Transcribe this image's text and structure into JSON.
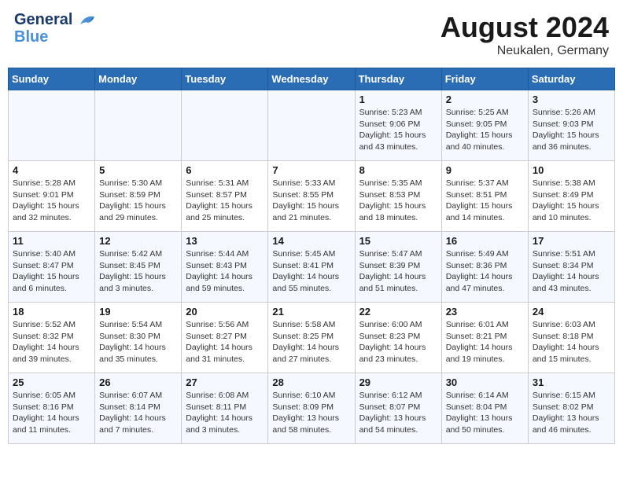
{
  "header": {
    "logo_line1": "General",
    "logo_line2": "Blue",
    "main_title": "August 2024",
    "subtitle": "Neukalen, Germany"
  },
  "days_of_week": [
    "Sunday",
    "Monday",
    "Tuesday",
    "Wednesday",
    "Thursday",
    "Friday",
    "Saturday"
  ],
  "weeks": [
    [
      {
        "day": "",
        "info": ""
      },
      {
        "day": "",
        "info": ""
      },
      {
        "day": "",
        "info": ""
      },
      {
        "day": "",
        "info": ""
      },
      {
        "day": "1",
        "info": "Sunrise: 5:23 AM\nSunset: 9:06 PM\nDaylight: 15 hours\nand 43 minutes."
      },
      {
        "day": "2",
        "info": "Sunrise: 5:25 AM\nSunset: 9:05 PM\nDaylight: 15 hours\nand 40 minutes."
      },
      {
        "day": "3",
        "info": "Sunrise: 5:26 AM\nSunset: 9:03 PM\nDaylight: 15 hours\nand 36 minutes."
      }
    ],
    [
      {
        "day": "4",
        "info": "Sunrise: 5:28 AM\nSunset: 9:01 PM\nDaylight: 15 hours\nand 32 minutes."
      },
      {
        "day": "5",
        "info": "Sunrise: 5:30 AM\nSunset: 8:59 PM\nDaylight: 15 hours\nand 29 minutes."
      },
      {
        "day": "6",
        "info": "Sunrise: 5:31 AM\nSunset: 8:57 PM\nDaylight: 15 hours\nand 25 minutes."
      },
      {
        "day": "7",
        "info": "Sunrise: 5:33 AM\nSunset: 8:55 PM\nDaylight: 15 hours\nand 21 minutes."
      },
      {
        "day": "8",
        "info": "Sunrise: 5:35 AM\nSunset: 8:53 PM\nDaylight: 15 hours\nand 18 minutes."
      },
      {
        "day": "9",
        "info": "Sunrise: 5:37 AM\nSunset: 8:51 PM\nDaylight: 15 hours\nand 14 minutes."
      },
      {
        "day": "10",
        "info": "Sunrise: 5:38 AM\nSunset: 8:49 PM\nDaylight: 15 hours\nand 10 minutes."
      }
    ],
    [
      {
        "day": "11",
        "info": "Sunrise: 5:40 AM\nSunset: 8:47 PM\nDaylight: 15 hours\nand 6 minutes."
      },
      {
        "day": "12",
        "info": "Sunrise: 5:42 AM\nSunset: 8:45 PM\nDaylight: 15 hours\nand 3 minutes."
      },
      {
        "day": "13",
        "info": "Sunrise: 5:44 AM\nSunset: 8:43 PM\nDaylight: 14 hours\nand 59 minutes."
      },
      {
        "day": "14",
        "info": "Sunrise: 5:45 AM\nSunset: 8:41 PM\nDaylight: 14 hours\nand 55 minutes."
      },
      {
        "day": "15",
        "info": "Sunrise: 5:47 AM\nSunset: 8:39 PM\nDaylight: 14 hours\nand 51 minutes."
      },
      {
        "day": "16",
        "info": "Sunrise: 5:49 AM\nSunset: 8:36 PM\nDaylight: 14 hours\nand 47 minutes."
      },
      {
        "day": "17",
        "info": "Sunrise: 5:51 AM\nSunset: 8:34 PM\nDaylight: 14 hours\nand 43 minutes."
      }
    ],
    [
      {
        "day": "18",
        "info": "Sunrise: 5:52 AM\nSunset: 8:32 PM\nDaylight: 14 hours\nand 39 minutes."
      },
      {
        "day": "19",
        "info": "Sunrise: 5:54 AM\nSunset: 8:30 PM\nDaylight: 14 hours\nand 35 minutes."
      },
      {
        "day": "20",
        "info": "Sunrise: 5:56 AM\nSunset: 8:27 PM\nDaylight: 14 hours\nand 31 minutes."
      },
      {
        "day": "21",
        "info": "Sunrise: 5:58 AM\nSunset: 8:25 PM\nDaylight: 14 hours\nand 27 minutes."
      },
      {
        "day": "22",
        "info": "Sunrise: 6:00 AM\nSunset: 8:23 PM\nDaylight: 14 hours\nand 23 minutes."
      },
      {
        "day": "23",
        "info": "Sunrise: 6:01 AM\nSunset: 8:21 PM\nDaylight: 14 hours\nand 19 minutes."
      },
      {
        "day": "24",
        "info": "Sunrise: 6:03 AM\nSunset: 8:18 PM\nDaylight: 14 hours\nand 15 minutes."
      }
    ],
    [
      {
        "day": "25",
        "info": "Sunrise: 6:05 AM\nSunset: 8:16 PM\nDaylight: 14 hours\nand 11 minutes."
      },
      {
        "day": "26",
        "info": "Sunrise: 6:07 AM\nSunset: 8:14 PM\nDaylight: 14 hours\nand 7 minutes."
      },
      {
        "day": "27",
        "info": "Sunrise: 6:08 AM\nSunset: 8:11 PM\nDaylight: 14 hours\nand 3 minutes."
      },
      {
        "day": "28",
        "info": "Sunrise: 6:10 AM\nSunset: 8:09 PM\nDaylight: 13 hours\nand 58 minutes."
      },
      {
        "day": "29",
        "info": "Sunrise: 6:12 AM\nSunset: 8:07 PM\nDaylight: 13 hours\nand 54 minutes."
      },
      {
        "day": "30",
        "info": "Sunrise: 6:14 AM\nSunset: 8:04 PM\nDaylight: 13 hours\nand 50 minutes."
      },
      {
        "day": "31",
        "info": "Sunrise: 6:15 AM\nSunset: 8:02 PM\nDaylight: 13 hours\nand 46 minutes."
      }
    ]
  ]
}
